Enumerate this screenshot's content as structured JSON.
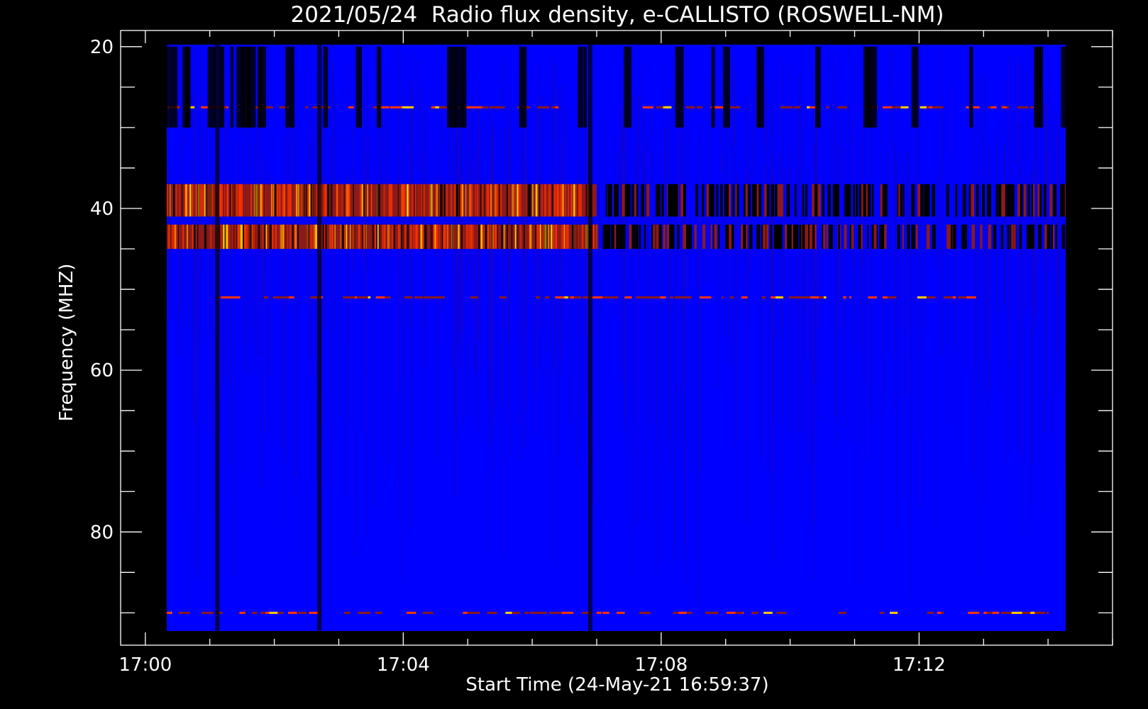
{
  "chart_data": {
    "type": "heatmap",
    "title": "2021/05/24  Radio flux density, e-CALLISTO (ROSWELL-NM)",
    "xlabel": "Start Time (24-May-21 16:59:37)",
    "ylabel": "Frequency (MHZ)",
    "x_range": [
      "16:59:37",
      "17:15:00"
    ],
    "data_range": [
      "17:00:00",
      "17:15:00"
    ],
    "y_range_mhz": [
      18,
      94
    ],
    "y_inverted": true,
    "x_ticks": [
      "17:00",
      "17:04",
      "17:08",
      "17:12"
    ],
    "y_ticks": [
      20,
      40,
      60,
      80
    ],
    "colormap": {
      "background": "#0000ff",
      "low": "#000000",
      "mid": "#8b1a1a",
      "high": "#ff3300",
      "peak": "#ffcc00"
    },
    "features": [
      {
        "label": "intense emission band",
        "freq_mhz": [
          37,
          41
        ],
        "time": [
          "17:00",
          "17:07"
        ]
      },
      {
        "label": "intense emission band",
        "freq_mhz": [
          42,
          45
        ],
        "time": [
          "17:00",
          "17:07"
        ]
      },
      {
        "label": "narrowband line",
        "freq_mhz": 27.5,
        "time": [
          "17:00",
          "17:15"
        ]
      },
      {
        "label": "narrowband line",
        "freq_mhz": 51,
        "time": [
          "17:01",
          "17:13"
        ]
      },
      {
        "label": "narrowband line",
        "freq_mhz": 90,
        "time": [
          "17:00",
          "17:15"
        ]
      }
    ]
  }
}
